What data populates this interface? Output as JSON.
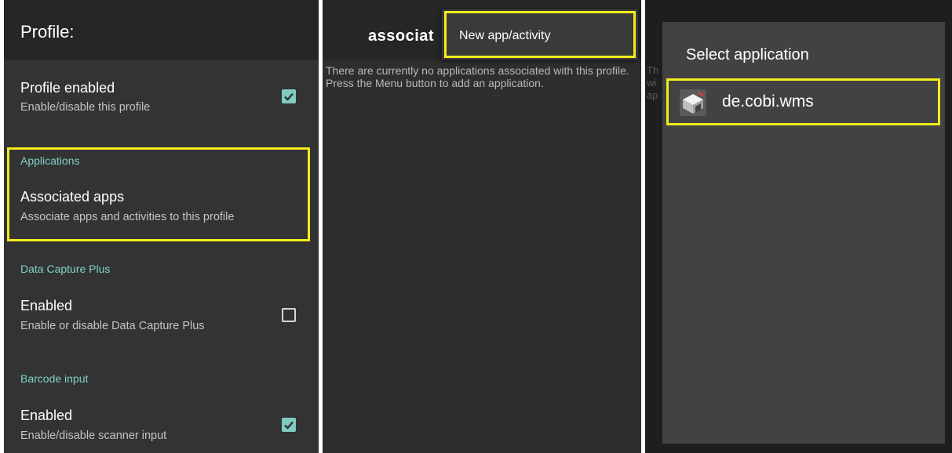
{
  "panel1": {
    "title": "Profile:",
    "profile_enabled": {
      "title": "Profile enabled",
      "summary": "Enable/disable this profile",
      "checked": true
    },
    "applications": {
      "category": "Applications",
      "title": "Associated apps",
      "summary": "Associate apps and activities to this profile"
    },
    "data_capture_plus": {
      "category": "Data Capture Plus",
      "title": "Enabled",
      "summary": "Enable or disable Data Capture Plus",
      "checked": false
    },
    "barcode_input": {
      "category": "Barcode input",
      "title": "Enabled",
      "summary": "Enable/disable scanner input",
      "checked": true
    }
  },
  "panel2": {
    "title": "associat",
    "menu_item": "New app/activity",
    "empty_message": "There are currently no applications associated with this profile. Press the Menu button to add an application."
  },
  "panel3": {
    "dialog_title": "Select application",
    "app_name": "de.cobi.wms",
    "bg_fragments": [
      "Th",
      "wi",
      "ap"
    ]
  },
  "colors": {
    "highlight": "#f2ec1c",
    "accent": "#80cbc4",
    "category": "#7fd1c8"
  },
  "icons": {
    "checkbox_on": "check-icon",
    "app": "wms-box-icon"
  }
}
